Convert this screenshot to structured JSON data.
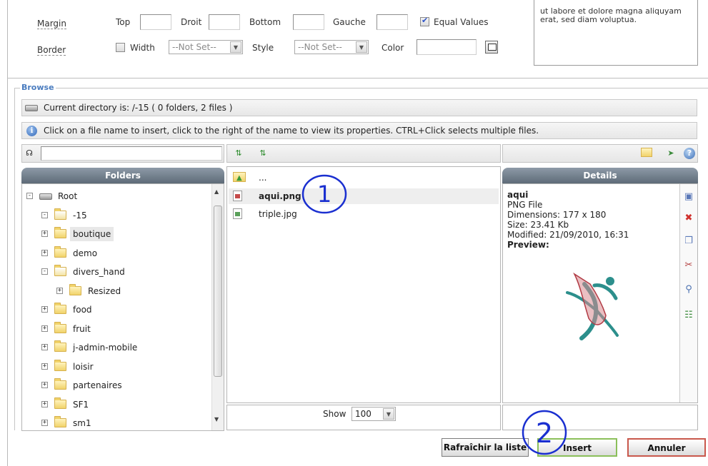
{
  "properties": {
    "margin_label": "Margin",
    "border_label": "Border",
    "top_label": "Top",
    "right_label": "Droit",
    "bottom_label": "Bottom",
    "left_label": "Gauche",
    "equal_values_label": "Equal Values",
    "equal_values_checked": true,
    "width_label": "Width",
    "width_checked": false,
    "width_select": "--Not Set--",
    "style_label": "Style",
    "style_select": "--Not Set--",
    "color_label": "Color",
    "preview_text": "ut labore et dolore magna aliquyam erat, sed diam voluptua."
  },
  "browse": {
    "legend": "Browse",
    "current_directory": "Current directory is: /-15 ( 0 folders, 2 files )",
    "hint": "Click on a file name to insert, click to the right of the name to view its properties. CTRL+Click selects multiple files.",
    "search_value": ""
  },
  "folders": {
    "header": "Folders",
    "tree": [
      {
        "label": "Root",
        "depth": 0,
        "expander": "-",
        "icon": "drive"
      },
      {
        "label": "-15",
        "depth": 1,
        "expander": "-",
        "icon": "folder-open"
      },
      {
        "label": "boutique",
        "depth": 1,
        "expander": "+",
        "icon": "folder",
        "selected": true
      },
      {
        "label": "demo",
        "depth": 1,
        "expander": "+",
        "icon": "folder"
      },
      {
        "label": "divers_hand",
        "depth": 1,
        "expander": "-",
        "icon": "folder-open"
      },
      {
        "label": "Resized",
        "depth": 2,
        "expander": "+",
        "icon": "folder"
      },
      {
        "label": "food",
        "depth": 1,
        "expander": "+",
        "icon": "folder"
      },
      {
        "label": "fruit",
        "depth": 1,
        "expander": "+",
        "icon": "folder"
      },
      {
        "label": "j-admin-mobile",
        "depth": 1,
        "expander": "+",
        "icon": "folder"
      },
      {
        "label": "loisir",
        "depth": 1,
        "expander": "+",
        "icon": "folder"
      },
      {
        "label": "partenaires",
        "depth": 1,
        "expander": "+",
        "icon": "folder"
      },
      {
        "label": "SF1",
        "depth": 1,
        "expander": "+",
        "icon": "folder"
      },
      {
        "label": "sm1",
        "depth": 1,
        "expander": "+",
        "icon": "folder"
      }
    ]
  },
  "files": {
    "parent_label": "...",
    "items": [
      {
        "name": "aqui.png",
        "type": "png",
        "selected": true
      },
      {
        "name": "triple.jpg",
        "type": "jpg",
        "selected": false
      }
    ],
    "show_label": "Show",
    "show_value": "100"
  },
  "details": {
    "header": "Details",
    "name": "aqui",
    "type": "PNG File",
    "dimensions": "Dimensions: 177 x 180",
    "size": "Size: 23.41 Kb",
    "modified": "Modified: 21/09/2010, 16:31",
    "preview_label": "Preview:"
  },
  "buttons": {
    "refresh": "Rafraîchir la liste",
    "insert": "Insert",
    "cancel": "Annuler"
  },
  "annotations": {
    "step1": "1",
    "step2": "2",
    "color": "#1a2fd0"
  },
  "colors": {
    "header_bg": "#6b7885",
    "legend": "#4a7cbf",
    "insert_border": "#8bbf5a",
    "cancel_border": "#c9584c"
  }
}
